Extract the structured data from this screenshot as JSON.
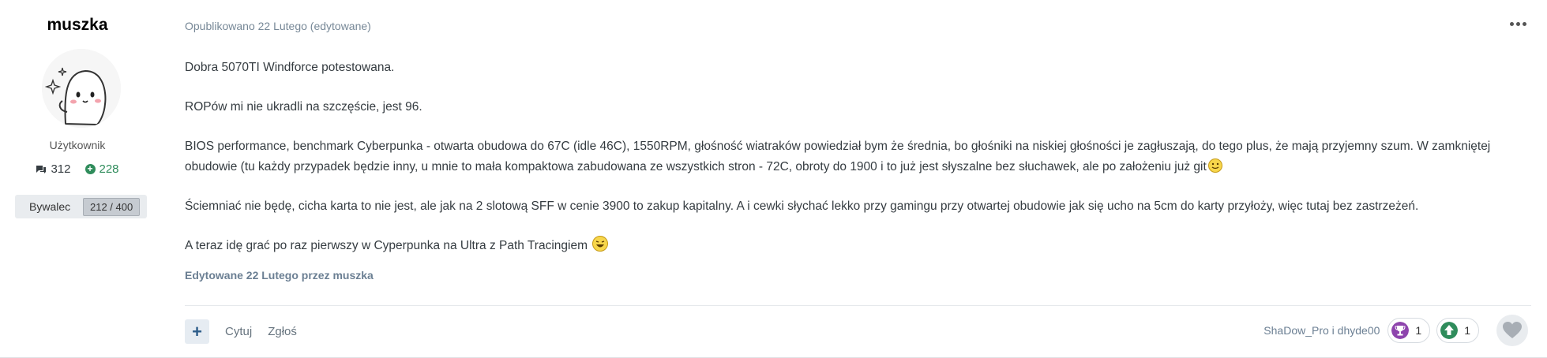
{
  "author": {
    "name": "muszka",
    "rank": "Użytkownik",
    "posts_count": "312",
    "reputation": "228",
    "badge_label": "Bywalec",
    "badge_progress": "212 / 400",
    "avatar_icon": "cartoon-ghost-avatar"
  },
  "post": {
    "meta": "Opublikowano 22 Lutego (edytowane)",
    "paragraphs": [
      "Dobra 5070TI Windforce potestowana.",
      "ROPów mi nie ukradli na szczęście, jest 96.",
      "BIOS performance, benchmark Cyberpunka - otwarta obudowa do 67C (idle 46C), 1550RPM, głośność wiatraków powiedział bym że średnia, bo głośniki na niskiej głośności je zagłuszają, do tego plus, że mają przyjemny szum. W zamkniętej obudowie (tu każdy przypadek będzie inny, u mnie to mała kompaktowa zabudowana ze wszystkich stron - 72C, obroty do 1900 i to już jest słyszalne bez słuchawek, ale po założeniu już git",
      "Ściemniać nie będę, cicha karta to nie jest, ale jak na 2 slotową SFF w cenie 3900 to zakup kapitalny. A i cewki słychać lekko przy gamingu przy otwartej obudowie jak się ucho na 5cm do karty przyłoży, więc tutaj bez zastrzeżeń.",
      "A teraz idę grać po raz pierwszy w Cyperpunka na Ultra z Path Tracingiem"
    ],
    "edited_note": "Edytowane 22 Lutego przez muszka"
  },
  "actions": {
    "add_label": "+",
    "quote_label": "Cytuj",
    "report_label": "Zgłoś"
  },
  "reactions": {
    "users": "ShaDow_Pro i dhyde00",
    "trophy_count": "1",
    "upvote_count": "1",
    "colors": {
      "trophy": "#8e44ad",
      "upvote": "#2f8c5b",
      "heart": "#a8aeb5"
    }
  }
}
